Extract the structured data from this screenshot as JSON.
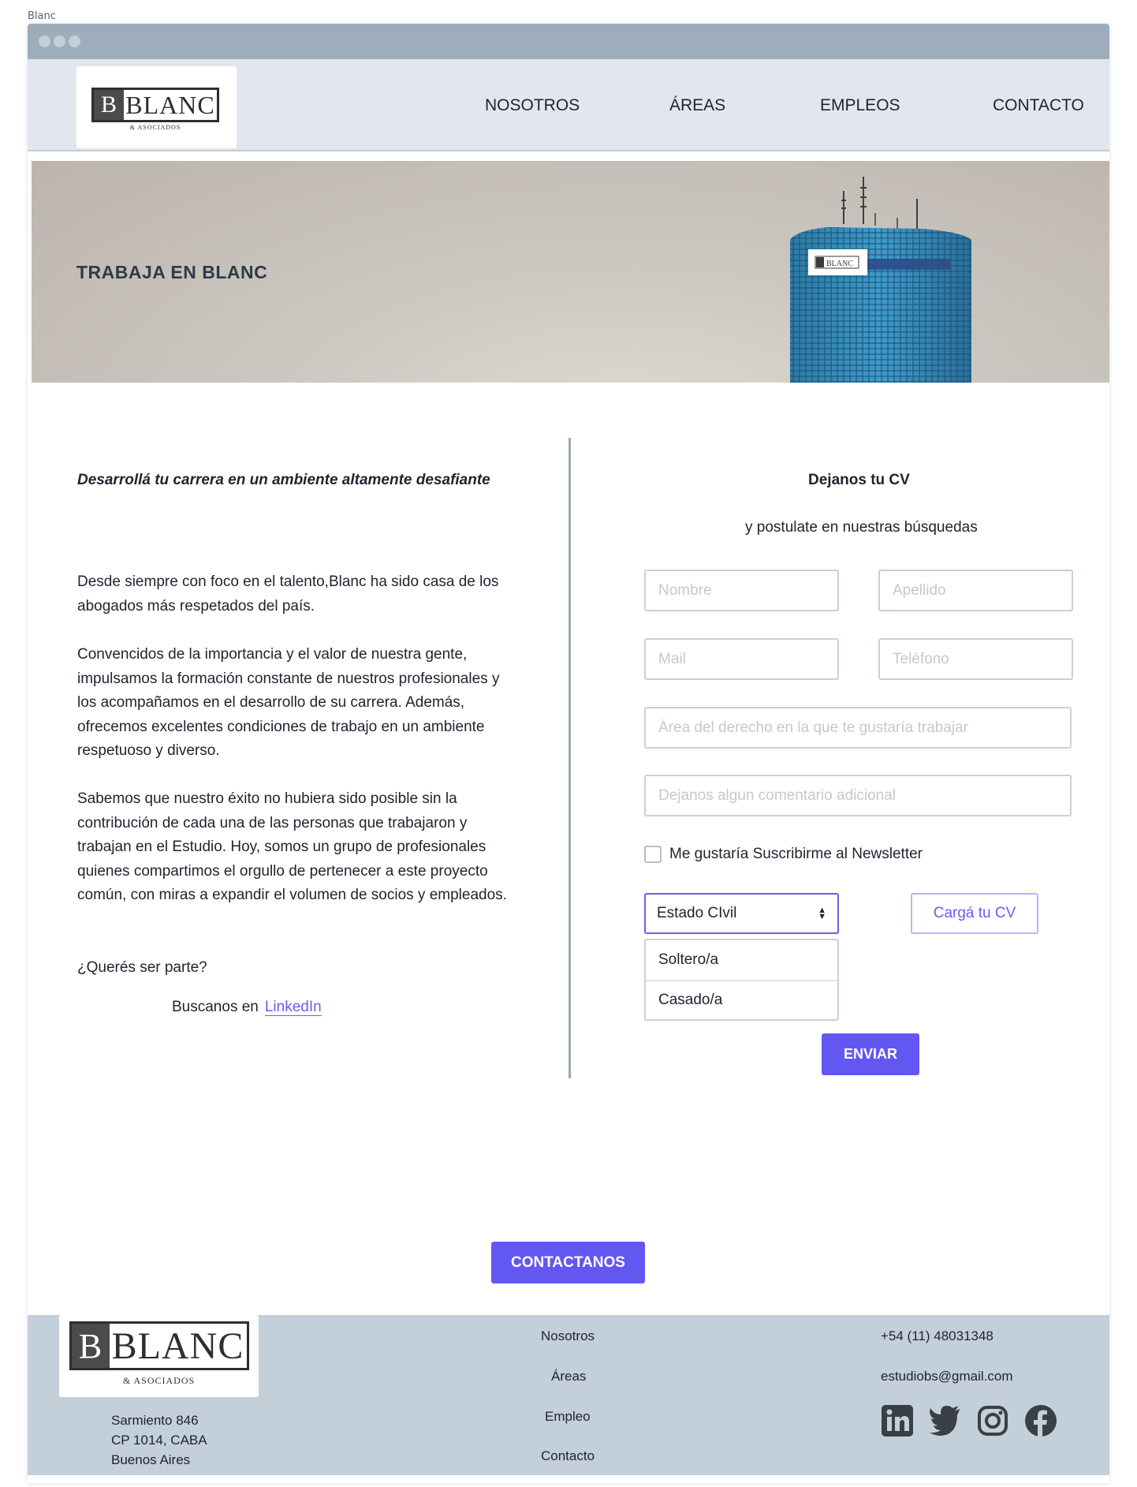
{
  "frame_labels": {
    "top": "Blanc",
    "footer": "footer"
  },
  "brand": {
    "initial": "B",
    "name": "BLANC",
    "tagline": "& ASOCIADOS"
  },
  "nav": {
    "items": [
      "NOSOTROS",
      "ÁREAS",
      "EMPLEOS",
      "CONTACTO"
    ]
  },
  "hero": {
    "title": "TRABAJA EN BLANC",
    "building_logo_text": "BLANC"
  },
  "left": {
    "tagline": "Desarrollá tu carrera en un ambiente altamente desafiante",
    "paragraphs": [
      "Desde siempre con foco en el talento,Blanc ha sido casa de los abogados más respetados del país.",
      "Convencidos de la importancia y el valor de nuestra gente, impulsamos la formación constante de nuestros profesionales y los acompañamos en el desarrollo de su carrera. Además, ofrecemos excelentes condiciones de trabajo en un ambiente respetuoso y diverso.",
      "Sabemos que nuestro éxito no hubiera sido posible sin la contribución de cada una de las personas que trabajaron y trabajan en el Estudio. Hoy, somos un grupo de profesionales quienes compartimos el orgullo de pertenecer a este proyecto común, con miras a expandir el volumen de socios y empleados.",
      "¿Querés ser parte?"
    ],
    "linkedin_prefix": "Buscanos en",
    "linkedin_label": "LinkedIn"
  },
  "form": {
    "title": "Dejanos tu CV",
    "subtitle": "y postulate en nuestras búsquedas",
    "placeholders": {
      "nombre": "Nombre",
      "apellido": "Apellido",
      "mail": "Mail",
      "telefono": "Teléfono",
      "area": "Área del derecho en la que te gustaría trabajar",
      "comentario": "Dejanos algun comentario adicional"
    },
    "newsletter_label": "Me gustaría Suscribirme al Newsletter",
    "newsletter_checked": false,
    "estado_civil": {
      "selected": "Estado CIvil",
      "options": [
        "Soltero/a",
        "Casado/a"
      ]
    },
    "cv_button": "Cargá tu CV",
    "submit": "ENVIAR"
  },
  "contact_button": "CONTACTANOS",
  "footer": {
    "address": [
      "Sarmiento 846",
      "CP 1014, CABA",
      "Buenos Aires"
    ],
    "nav": [
      "Nosotros",
      "Áreas",
      "Empleo",
      "Contacto"
    ],
    "phone": "+54 (11) 48031348",
    "email": "estudiobs@gmail.com",
    "social_icons": [
      "linkedin-icon",
      "twitter-icon",
      "instagram-icon",
      "facebook-icon"
    ]
  },
  "colors": {
    "accent": "#6357f2",
    "titlebar": "#9eadbb",
    "navbar": "#e2e7ef",
    "footer": "#c3cfd9"
  }
}
